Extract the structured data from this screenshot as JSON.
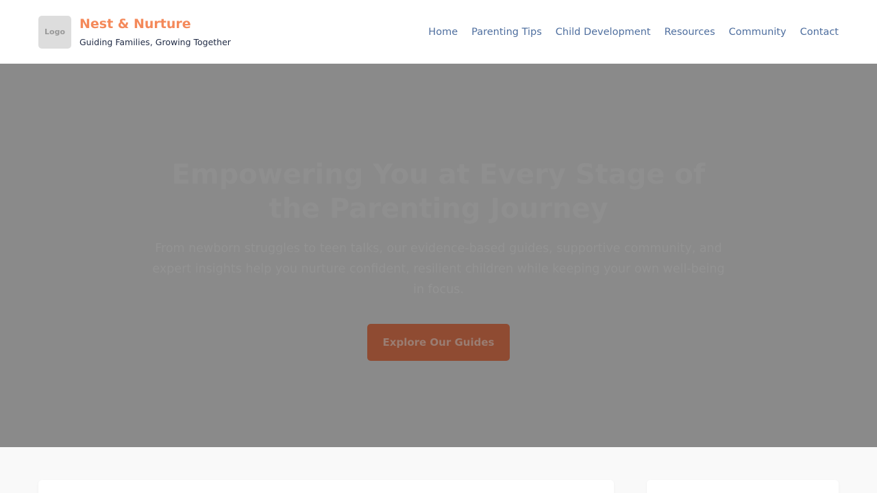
{
  "header": {
    "logo_label": "Logo",
    "brand_title": "Nest & Nurture",
    "tagline": "Guiding Families, Growing Together",
    "nav": [
      {
        "label": "Home"
      },
      {
        "label": "Parenting Tips"
      },
      {
        "label": "Child Development"
      },
      {
        "label": "Resources"
      },
      {
        "label": "Community"
      },
      {
        "label": "Contact"
      }
    ]
  },
  "hero": {
    "title": "Empowering You at Every Stage of the Parenting Journey",
    "subtitle": "From newborn struggles to teen talks, our evidence-based guides, supportive community, and expert insights help you nurture confident, resilient children while keeping your own well-being in focus.",
    "cta_label": "Explore Our Guides"
  },
  "colors": {
    "accent": "#f4895a",
    "nav_link": "#4f6f9f",
    "overlay": "#8a8a8a"
  }
}
